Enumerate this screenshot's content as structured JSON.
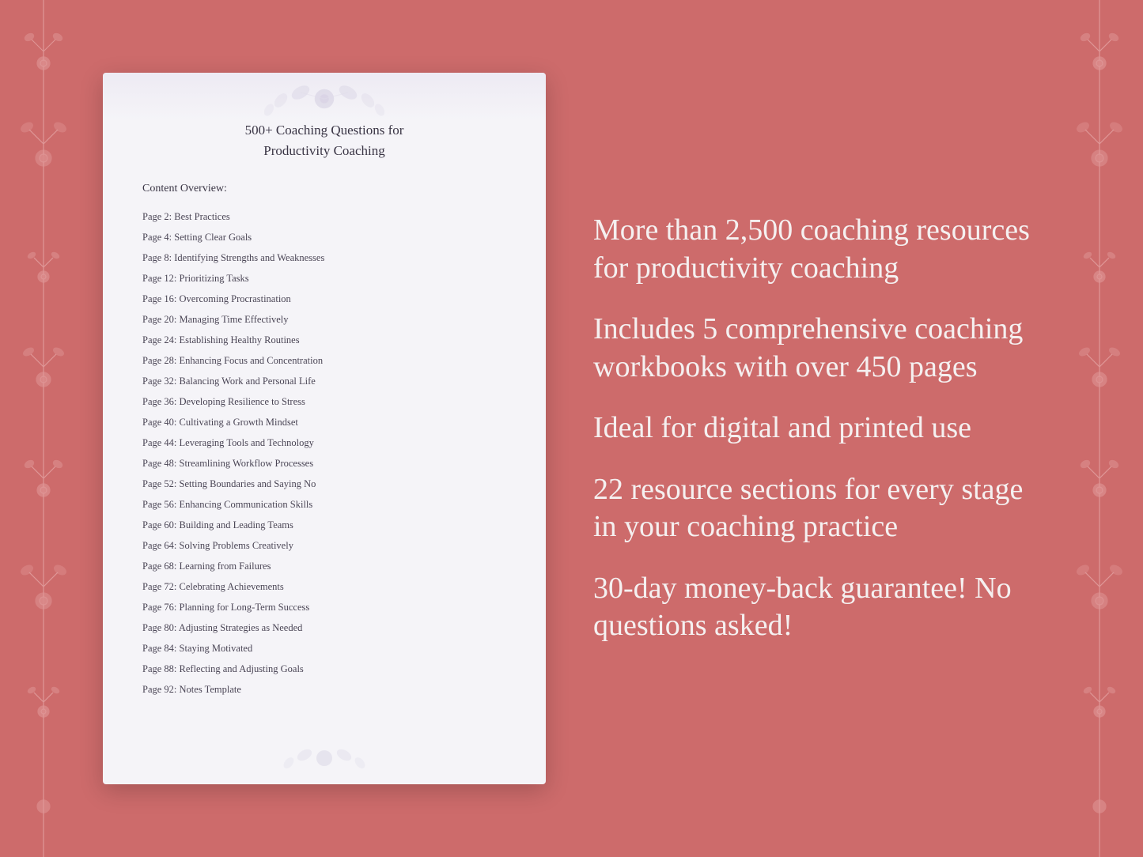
{
  "background": {
    "color": "#cd6b6b"
  },
  "document": {
    "title_line1": "500+ Coaching Questions for",
    "title_line2": "Productivity Coaching",
    "content_overview_label": "Content Overview:",
    "toc_items": [
      "Page  2:  Best Practices",
      "Page  4:  Setting Clear Goals",
      "Page  8:  Identifying Strengths and Weaknesses",
      "Page 12:  Prioritizing Tasks",
      "Page 16:  Overcoming Procrastination",
      "Page 20:  Managing Time Effectively",
      "Page 24:  Establishing Healthy Routines",
      "Page 28:  Enhancing Focus and Concentration",
      "Page 32:  Balancing Work and Personal Life",
      "Page 36:  Developing Resilience to Stress",
      "Page 40:  Cultivating a Growth Mindset",
      "Page 44:  Leveraging Tools and Technology",
      "Page 48:  Streamlining Workflow Processes",
      "Page 52:  Setting Boundaries and Saying No",
      "Page 56:  Enhancing Communication Skills",
      "Page 60:  Building and Leading Teams",
      "Page 64:  Solving Problems Creatively",
      "Page 68:  Learning from Failures",
      "Page 72:  Celebrating Achievements",
      "Page 76:  Planning for Long-Term Success",
      "Page 80:  Adjusting Strategies as Needed",
      "Page 84:  Staying Motivated",
      "Page 88:  Reflecting and Adjusting Goals",
      "Page 92:  Notes Template"
    ]
  },
  "features": [
    {
      "text": "More than 2,500 coaching resources for productivity coaching"
    },
    {
      "text": "Includes 5 comprehensive coaching workbooks with over 450 pages"
    },
    {
      "text": "Ideal for digital and printed use"
    },
    {
      "text": "22 resource sections for every stage in your coaching practice"
    },
    {
      "text": "30-day money-back guarantee! No questions asked!"
    }
  ]
}
